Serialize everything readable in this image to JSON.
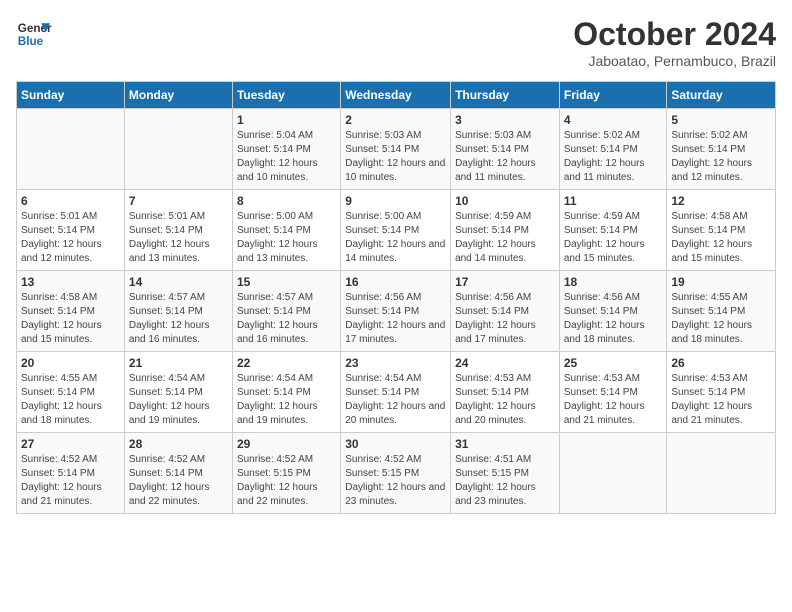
{
  "header": {
    "logo_line1": "General",
    "logo_line2": "Blue",
    "title": "October 2024",
    "subtitle": "Jaboatao, Pernambuco, Brazil"
  },
  "days_of_week": [
    "Sunday",
    "Monday",
    "Tuesday",
    "Wednesday",
    "Thursday",
    "Friday",
    "Saturday"
  ],
  "weeks": [
    [
      {
        "day": "",
        "info": ""
      },
      {
        "day": "",
        "info": ""
      },
      {
        "day": "1",
        "info": "Sunrise: 5:04 AM\nSunset: 5:14 PM\nDaylight: 12 hours and 10 minutes."
      },
      {
        "day": "2",
        "info": "Sunrise: 5:03 AM\nSunset: 5:14 PM\nDaylight: 12 hours and 10 minutes."
      },
      {
        "day": "3",
        "info": "Sunrise: 5:03 AM\nSunset: 5:14 PM\nDaylight: 12 hours and 11 minutes."
      },
      {
        "day": "4",
        "info": "Sunrise: 5:02 AM\nSunset: 5:14 PM\nDaylight: 12 hours and 11 minutes."
      },
      {
        "day": "5",
        "info": "Sunrise: 5:02 AM\nSunset: 5:14 PM\nDaylight: 12 hours and 12 minutes."
      }
    ],
    [
      {
        "day": "6",
        "info": "Sunrise: 5:01 AM\nSunset: 5:14 PM\nDaylight: 12 hours and 12 minutes."
      },
      {
        "day": "7",
        "info": "Sunrise: 5:01 AM\nSunset: 5:14 PM\nDaylight: 12 hours and 13 minutes."
      },
      {
        "day": "8",
        "info": "Sunrise: 5:00 AM\nSunset: 5:14 PM\nDaylight: 12 hours and 13 minutes."
      },
      {
        "day": "9",
        "info": "Sunrise: 5:00 AM\nSunset: 5:14 PM\nDaylight: 12 hours and 14 minutes."
      },
      {
        "day": "10",
        "info": "Sunrise: 4:59 AM\nSunset: 5:14 PM\nDaylight: 12 hours and 14 minutes."
      },
      {
        "day": "11",
        "info": "Sunrise: 4:59 AM\nSunset: 5:14 PM\nDaylight: 12 hours and 15 minutes."
      },
      {
        "day": "12",
        "info": "Sunrise: 4:58 AM\nSunset: 5:14 PM\nDaylight: 12 hours and 15 minutes."
      }
    ],
    [
      {
        "day": "13",
        "info": "Sunrise: 4:58 AM\nSunset: 5:14 PM\nDaylight: 12 hours and 15 minutes."
      },
      {
        "day": "14",
        "info": "Sunrise: 4:57 AM\nSunset: 5:14 PM\nDaylight: 12 hours and 16 minutes."
      },
      {
        "day": "15",
        "info": "Sunrise: 4:57 AM\nSunset: 5:14 PM\nDaylight: 12 hours and 16 minutes."
      },
      {
        "day": "16",
        "info": "Sunrise: 4:56 AM\nSunset: 5:14 PM\nDaylight: 12 hours and 17 minutes."
      },
      {
        "day": "17",
        "info": "Sunrise: 4:56 AM\nSunset: 5:14 PM\nDaylight: 12 hours and 17 minutes."
      },
      {
        "day": "18",
        "info": "Sunrise: 4:56 AM\nSunset: 5:14 PM\nDaylight: 12 hours and 18 minutes."
      },
      {
        "day": "19",
        "info": "Sunrise: 4:55 AM\nSunset: 5:14 PM\nDaylight: 12 hours and 18 minutes."
      }
    ],
    [
      {
        "day": "20",
        "info": "Sunrise: 4:55 AM\nSunset: 5:14 PM\nDaylight: 12 hours and 18 minutes."
      },
      {
        "day": "21",
        "info": "Sunrise: 4:54 AM\nSunset: 5:14 PM\nDaylight: 12 hours and 19 minutes."
      },
      {
        "day": "22",
        "info": "Sunrise: 4:54 AM\nSunset: 5:14 PM\nDaylight: 12 hours and 19 minutes."
      },
      {
        "day": "23",
        "info": "Sunrise: 4:54 AM\nSunset: 5:14 PM\nDaylight: 12 hours and 20 minutes."
      },
      {
        "day": "24",
        "info": "Sunrise: 4:53 AM\nSunset: 5:14 PM\nDaylight: 12 hours and 20 minutes."
      },
      {
        "day": "25",
        "info": "Sunrise: 4:53 AM\nSunset: 5:14 PM\nDaylight: 12 hours and 21 minutes."
      },
      {
        "day": "26",
        "info": "Sunrise: 4:53 AM\nSunset: 5:14 PM\nDaylight: 12 hours and 21 minutes."
      }
    ],
    [
      {
        "day": "27",
        "info": "Sunrise: 4:52 AM\nSunset: 5:14 PM\nDaylight: 12 hours and 21 minutes."
      },
      {
        "day": "28",
        "info": "Sunrise: 4:52 AM\nSunset: 5:14 PM\nDaylight: 12 hours and 22 minutes."
      },
      {
        "day": "29",
        "info": "Sunrise: 4:52 AM\nSunset: 5:15 PM\nDaylight: 12 hours and 22 minutes."
      },
      {
        "day": "30",
        "info": "Sunrise: 4:52 AM\nSunset: 5:15 PM\nDaylight: 12 hours and 23 minutes."
      },
      {
        "day": "31",
        "info": "Sunrise: 4:51 AM\nSunset: 5:15 PM\nDaylight: 12 hours and 23 minutes."
      },
      {
        "day": "",
        "info": ""
      },
      {
        "day": "",
        "info": ""
      }
    ]
  ]
}
